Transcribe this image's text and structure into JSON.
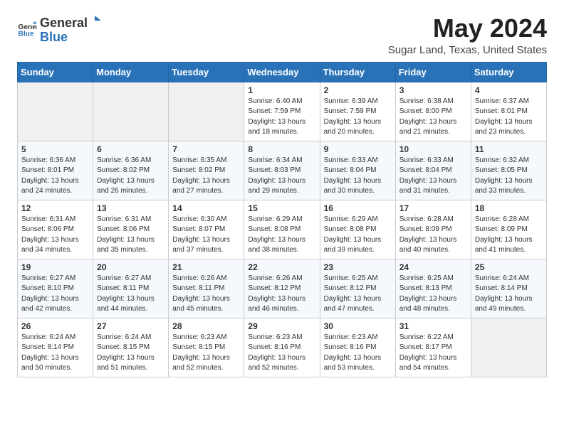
{
  "header": {
    "logo_general": "General",
    "logo_blue": "Blue",
    "title": "May 2024",
    "subtitle": "Sugar Land, Texas, United States"
  },
  "days_of_week": [
    "Sunday",
    "Monday",
    "Tuesday",
    "Wednesday",
    "Thursday",
    "Friday",
    "Saturday"
  ],
  "weeks": [
    [
      {
        "day": "",
        "info": ""
      },
      {
        "day": "",
        "info": ""
      },
      {
        "day": "",
        "info": ""
      },
      {
        "day": "1",
        "info": "Sunrise: 6:40 AM\nSunset: 7:59 PM\nDaylight: 13 hours\nand 18 minutes."
      },
      {
        "day": "2",
        "info": "Sunrise: 6:39 AM\nSunset: 7:59 PM\nDaylight: 13 hours\nand 20 minutes."
      },
      {
        "day": "3",
        "info": "Sunrise: 6:38 AM\nSunset: 8:00 PM\nDaylight: 13 hours\nand 21 minutes."
      },
      {
        "day": "4",
        "info": "Sunrise: 6:37 AM\nSunset: 8:01 PM\nDaylight: 13 hours\nand 23 minutes."
      }
    ],
    [
      {
        "day": "5",
        "info": "Sunrise: 6:36 AM\nSunset: 8:01 PM\nDaylight: 13 hours\nand 24 minutes."
      },
      {
        "day": "6",
        "info": "Sunrise: 6:36 AM\nSunset: 8:02 PM\nDaylight: 13 hours\nand 26 minutes."
      },
      {
        "day": "7",
        "info": "Sunrise: 6:35 AM\nSunset: 8:02 PM\nDaylight: 13 hours\nand 27 minutes."
      },
      {
        "day": "8",
        "info": "Sunrise: 6:34 AM\nSunset: 8:03 PM\nDaylight: 13 hours\nand 29 minutes."
      },
      {
        "day": "9",
        "info": "Sunrise: 6:33 AM\nSunset: 8:04 PM\nDaylight: 13 hours\nand 30 minutes."
      },
      {
        "day": "10",
        "info": "Sunrise: 6:33 AM\nSunset: 8:04 PM\nDaylight: 13 hours\nand 31 minutes."
      },
      {
        "day": "11",
        "info": "Sunrise: 6:32 AM\nSunset: 8:05 PM\nDaylight: 13 hours\nand 33 minutes."
      }
    ],
    [
      {
        "day": "12",
        "info": "Sunrise: 6:31 AM\nSunset: 8:06 PM\nDaylight: 13 hours\nand 34 minutes."
      },
      {
        "day": "13",
        "info": "Sunrise: 6:31 AM\nSunset: 8:06 PM\nDaylight: 13 hours\nand 35 minutes."
      },
      {
        "day": "14",
        "info": "Sunrise: 6:30 AM\nSunset: 8:07 PM\nDaylight: 13 hours\nand 37 minutes."
      },
      {
        "day": "15",
        "info": "Sunrise: 6:29 AM\nSunset: 8:08 PM\nDaylight: 13 hours\nand 38 minutes."
      },
      {
        "day": "16",
        "info": "Sunrise: 6:29 AM\nSunset: 8:08 PM\nDaylight: 13 hours\nand 39 minutes."
      },
      {
        "day": "17",
        "info": "Sunrise: 6:28 AM\nSunset: 8:09 PM\nDaylight: 13 hours\nand 40 minutes."
      },
      {
        "day": "18",
        "info": "Sunrise: 6:28 AM\nSunset: 8:09 PM\nDaylight: 13 hours\nand 41 minutes."
      }
    ],
    [
      {
        "day": "19",
        "info": "Sunrise: 6:27 AM\nSunset: 8:10 PM\nDaylight: 13 hours\nand 42 minutes."
      },
      {
        "day": "20",
        "info": "Sunrise: 6:27 AM\nSunset: 8:11 PM\nDaylight: 13 hours\nand 44 minutes."
      },
      {
        "day": "21",
        "info": "Sunrise: 6:26 AM\nSunset: 8:11 PM\nDaylight: 13 hours\nand 45 minutes."
      },
      {
        "day": "22",
        "info": "Sunrise: 6:26 AM\nSunset: 8:12 PM\nDaylight: 13 hours\nand 46 minutes."
      },
      {
        "day": "23",
        "info": "Sunrise: 6:25 AM\nSunset: 8:12 PM\nDaylight: 13 hours\nand 47 minutes."
      },
      {
        "day": "24",
        "info": "Sunrise: 6:25 AM\nSunset: 8:13 PM\nDaylight: 13 hours\nand 48 minutes."
      },
      {
        "day": "25",
        "info": "Sunrise: 6:24 AM\nSunset: 8:14 PM\nDaylight: 13 hours\nand 49 minutes."
      }
    ],
    [
      {
        "day": "26",
        "info": "Sunrise: 6:24 AM\nSunset: 8:14 PM\nDaylight: 13 hours\nand 50 minutes."
      },
      {
        "day": "27",
        "info": "Sunrise: 6:24 AM\nSunset: 8:15 PM\nDaylight: 13 hours\nand 51 minutes."
      },
      {
        "day": "28",
        "info": "Sunrise: 6:23 AM\nSunset: 8:15 PM\nDaylight: 13 hours\nand 52 minutes."
      },
      {
        "day": "29",
        "info": "Sunrise: 6:23 AM\nSunset: 8:16 PM\nDaylight: 13 hours\nand 52 minutes."
      },
      {
        "day": "30",
        "info": "Sunrise: 6:23 AM\nSunset: 8:16 PM\nDaylight: 13 hours\nand 53 minutes."
      },
      {
        "day": "31",
        "info": "Sunrise: 6:22 AM\nSunset: 8:17 PM\nDaylight: 13 hours\nand 54 minutes."
      },
      {
        "day": "",
        "info": ""
      }
    ]
  ]
}
